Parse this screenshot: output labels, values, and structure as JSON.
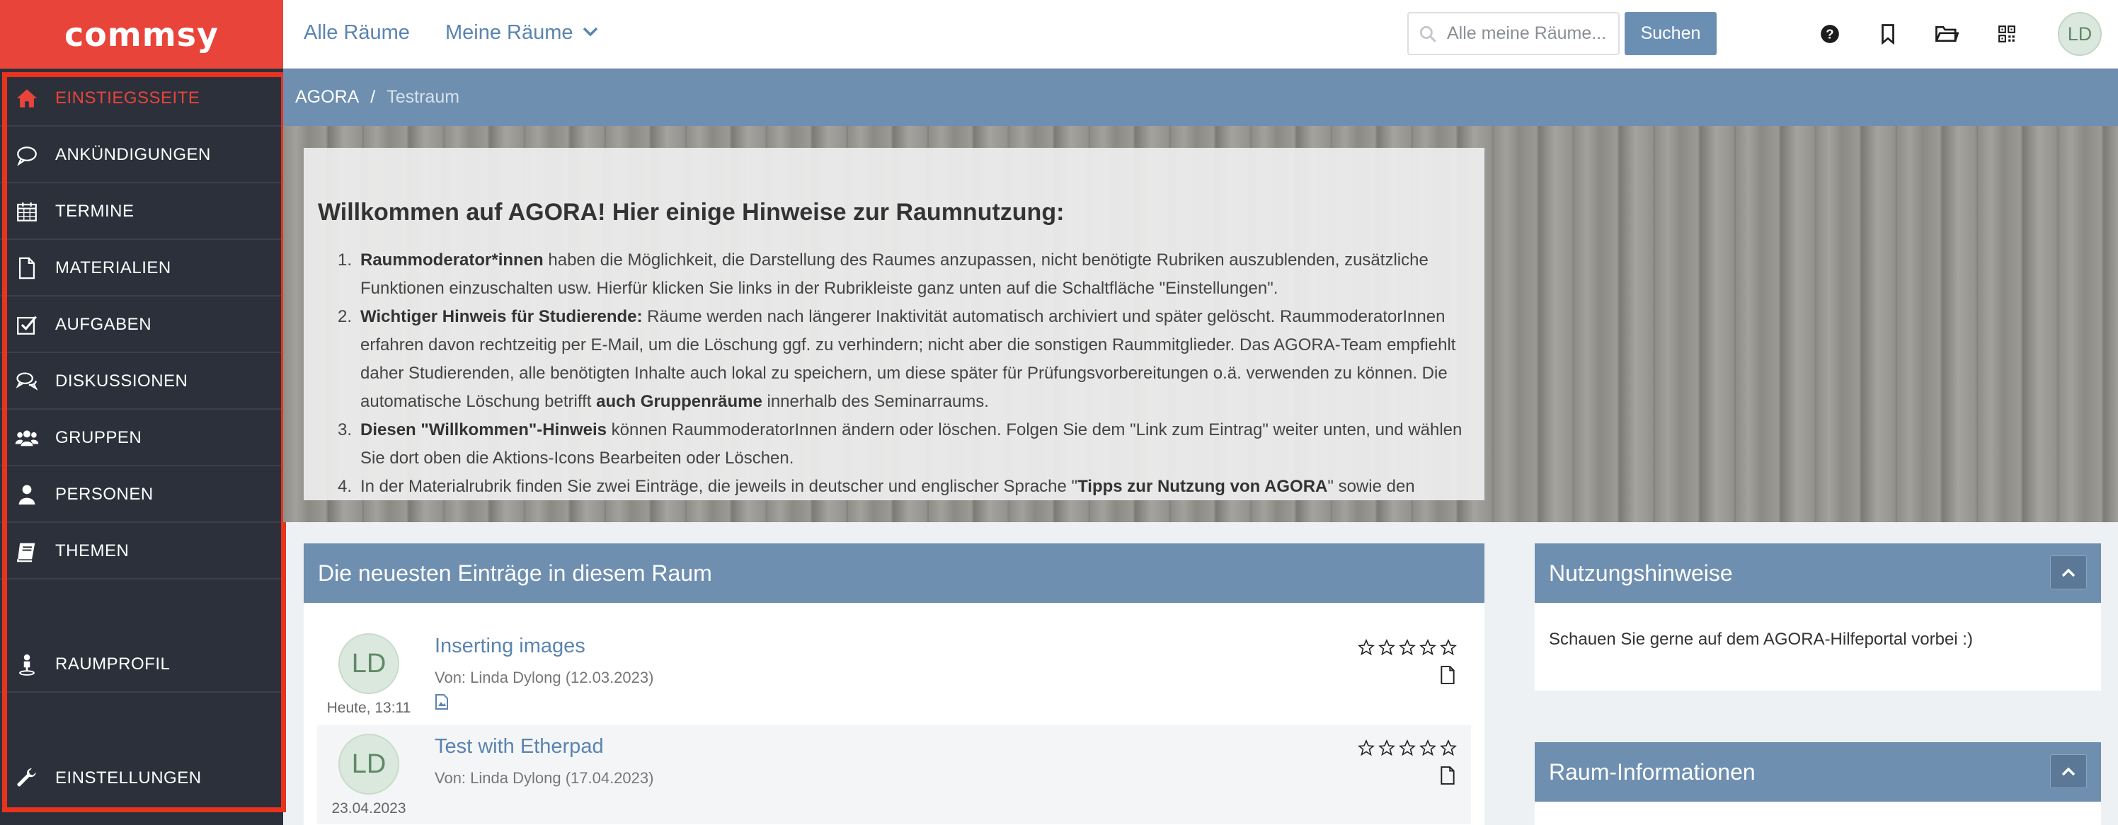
{
  "logo": {
    "text": "commsy"
  },
  "sidebar": {
    "items": [
      {
        "label": "EINSTIEGSSEITE",
        "icon": "home-icon"
      },
      {
        "label": "ANKÜNDIGUNGEN",
        "icon": "speech-bubble-icon"
      },
      {
        "label": "TERMINE",
        "icon": "calendar-icon"
      },
      {
        "label": "MATERIALIEN",
        "icon": "document-icon"
      },
      {
        "label": "AUFGABEN",
        "icon": "checkbox-icon"
      },
      {
        "label": "DISKUSSIONEN",
        "icon": "discussion-icon"
      },
      {
        "label": "GRUPPEN",
        "icon": "group-icon"
      },
      {
        "label": "PERSONEN",
        "icon": "person-icon"
      },
      {
        "label": "THEMEN",
        "icon": "book-icon"
      },
      {
        "label": "RAUMPROFIL",
        "icon": "profile-icon"
      },
      {
        "label": "EINSTELLUNGEN",
        "icon": "wrench-icon"
      }
    ],
    "active_color": "#e8443a",
    "highlight_color": "#e8331f"
  },
  "topbar": {
    "all_rooms": "Alle Räume",
    "my_rooms": "Meine Räume",
    "search_placeholder": "Alle meine Räume...",
    "search_button": "Suchen",
    "icons": [
      "help-icon",
      "bookmark-icon",
      "folder-icon",
      "qr-code-icon"
    ],
    "avatar_initials": "LD"
  },
  "breadcrumb": {
    "root": "AGORA",
    "separator": "/",
    "current": "Testraum"
  },
  "welcome": {
    "title": "Willkommen auf AGORA! Hier einige Hinweise zur Raumnutzung:",
    "items": [
      {
        "num": "1.",
        "bold": "Raummoderator*innen",
        "text": " haben die Möglichkeit, die Darstellung des Raumes anzupassen, nicht benötigte Rubriken auszublenden, zusätzliche Funktionen einzuschalten usw. Hierfür klicken Sie links in der Rubrikleiste ganz unten auf die Schaltfläche \"Einstellungen\"."
      },
      {
        "num": "2.",
        "bold": "Wichtiger Hinweis für Studierende:",
        "text": " Räume werden nach längerer Inaktivität automatisch archiviert und später gelöscht. RaummoderatorInnen erfahren davon rechtzeitig per E-Mail, um die Löschung ggf. zu verhindern; nicht aber die sonstigen Raummitglieder. Das AGORA-Team empfiehlt daher Studierenden, alle benötigten Inhalte auch lokal zu speichern, um diese später für Prüfungsvorbereitungen o.ä. verwenden zu können. Die automatische Löschung betrifft ",
        "bold2": "auch Gruppenräume",
        "text2": " innerhalb des Seminarraums."
      },
      {
        "num": "3.",
        "bold": "Diesen \"Willkommen\"-Hinweis",
        "text": " können RaummoderatorInnen ändern oder löschen. Folgen Sie dem \"Link zum Eintrag\" weiter unten, und wählen Sie dort oben die Aktions-Icons Bearbeiten oder Löschen."
      },
      {
        "num": "4.",
        "text": "In der Materialrubrik finden Sie zwei Einträge, die jeweils in deutscher und englischer Sprache \"",
        "bold": "Tipps zur Nutzung von AGORA",
        "text2": "\" sowie den"
      }
    ]
  },
  "latest_entries": {
    "title": "Die neuesten Einträge in diesem Raum",
    "entries": [
      {
        "initials": "LD",
        "date": "Heute, 13:11",
        "title": "Inserting images",
        "meta": "Von: Linda Dylong (12.03.2023)",
        "has_attachment": true
      },
      {
        "initials": "LD",
        "date": "23.04.2023",
        "title": "Test with Etherpad",
        "meta": "Von: Linda Dylong (17.04.2023)",
        "has_attachment": false
      }
    ]
  },
  "usage_panel": {
    "title": "Nutzungshinweise",
    "text": "Schauen Sie gerne auf dem AGORA-Hilfeportal vorbei :)"
  },
  "room_info_panel": {
    "title": "Raum-Informationen"
  }
}
